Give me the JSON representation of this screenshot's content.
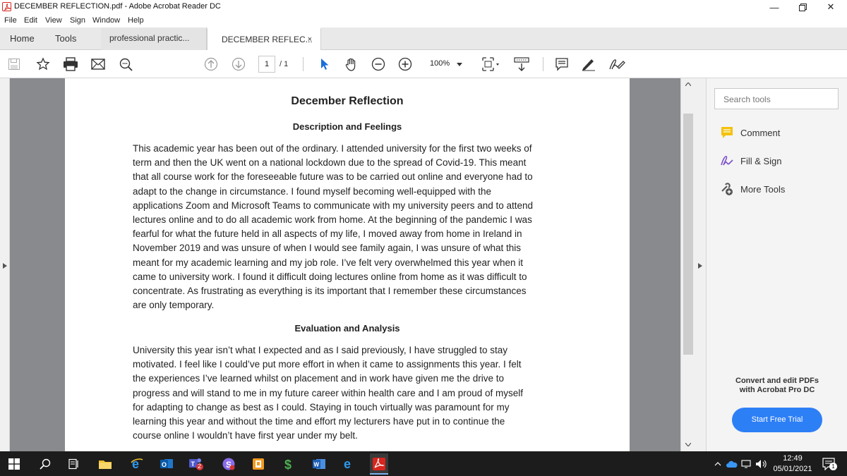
{
  "window": {
    "title": "DECEMBER REFLECTION.pdf - Adobe Acrobat Reader DC",
    "minimize": "—",
    "restore": "❐",
    "close": "✕"
  },
  "menu": [
    "File",
    "Edit",
    "View",
    "Sign",
    "Window",
    "Help"
  ],
  "tabs": {
    "home": "Home",
    "tools": "Tools",
    "docs": [
      {
        "label": "professional practic...",
        "active": false
      },
      {
        "label": "DECEMBER REFLEC...",
        "active": true,
        "close": "×"
      }
    ]
  },
  "toolbar": {
    "page_current": "1",
    "page_total": "/ 1",
    "zoom": "100%"
  },
  "document": {
    "title": "December Reflection",
    "sections": [
      {
        "heading": "Description and Feelings",
        "lines": [
          "This academic year has been out of the ordinary. I attended university for the first two weeks of",
          "term and then the UK went on a national lockdown due to the spread of Covid-19. This meant",
          "that all course work for the foreseeable future was to be carried out online and everyone had to",
          "adapt to the change in circumstance. I found myself becoming well-equipped with the",
          "applications Zoom and Microsoft Teams to communicate with my university peers and to attend",
          "lectures online and to do all academic work from home. At the beginning of the pandemic I was",
          "fearful for what the future held in all aspects of my life, I moved away from home in Ireland in",
          "November 2019 and was unsure of when I would see family again, I was unsure of what this",
          "meant for my academic learning and my job role. I’ve felt very overwhelmed this year when it",
          "came to university work. I found it difficult doing lectures online from home as it was difficult to",
          "concentrate. As frustrating as everything is its important that I remember these circumstances",
          "are only temporary."
        ]
      },
      {
        "heading": "Evaluation and Analysis",
        "lines": [
          "University this year isn’t what I expected and as I said previously, I have struggled to stay",
          "motivated. I feel like I could’ve put more effort in when it came to assignments this year. I felt",
          "the experiences I’ve learned whilst on placement and in work have given me the drive to",
          "progress and will stand to me in my future career within health care and I am proud of myself",
          "for adapting to change as best as I could. Staying in touch virtually was paramount for my",
          "learning this year and without the time and effort my lecturers have put in to continue the",
          "course online I wouldn’t have first year under my belt."
        ]
      }
    ]
  },
  "right_pane": {
    "search_placeholder": "Search tools",
    "tools": [
      "Comment",
      "Fill & Sign",
      "More Tools"
    ],
    "promo_line1": "Convert and edit PDFs",
    "promo_line2": "with Acrobat Pro DC",
    "trial_button": "Start Free Trial"
  },
  "taskbar": {
    "time": "12:49",
    "date": "05/01/2021",
    "teams_badge": "2",
    "notification_count": "1"
  },
  "colors": {
    "acrobat_red": "#d7261e",
    "accent_blue": "#2d7ff6",
    "comment_yellow": "#f4c20d",
    "fill_sign_purple": "#7b4fc9",
    "doc_background": "#888a8d"
  }
}
